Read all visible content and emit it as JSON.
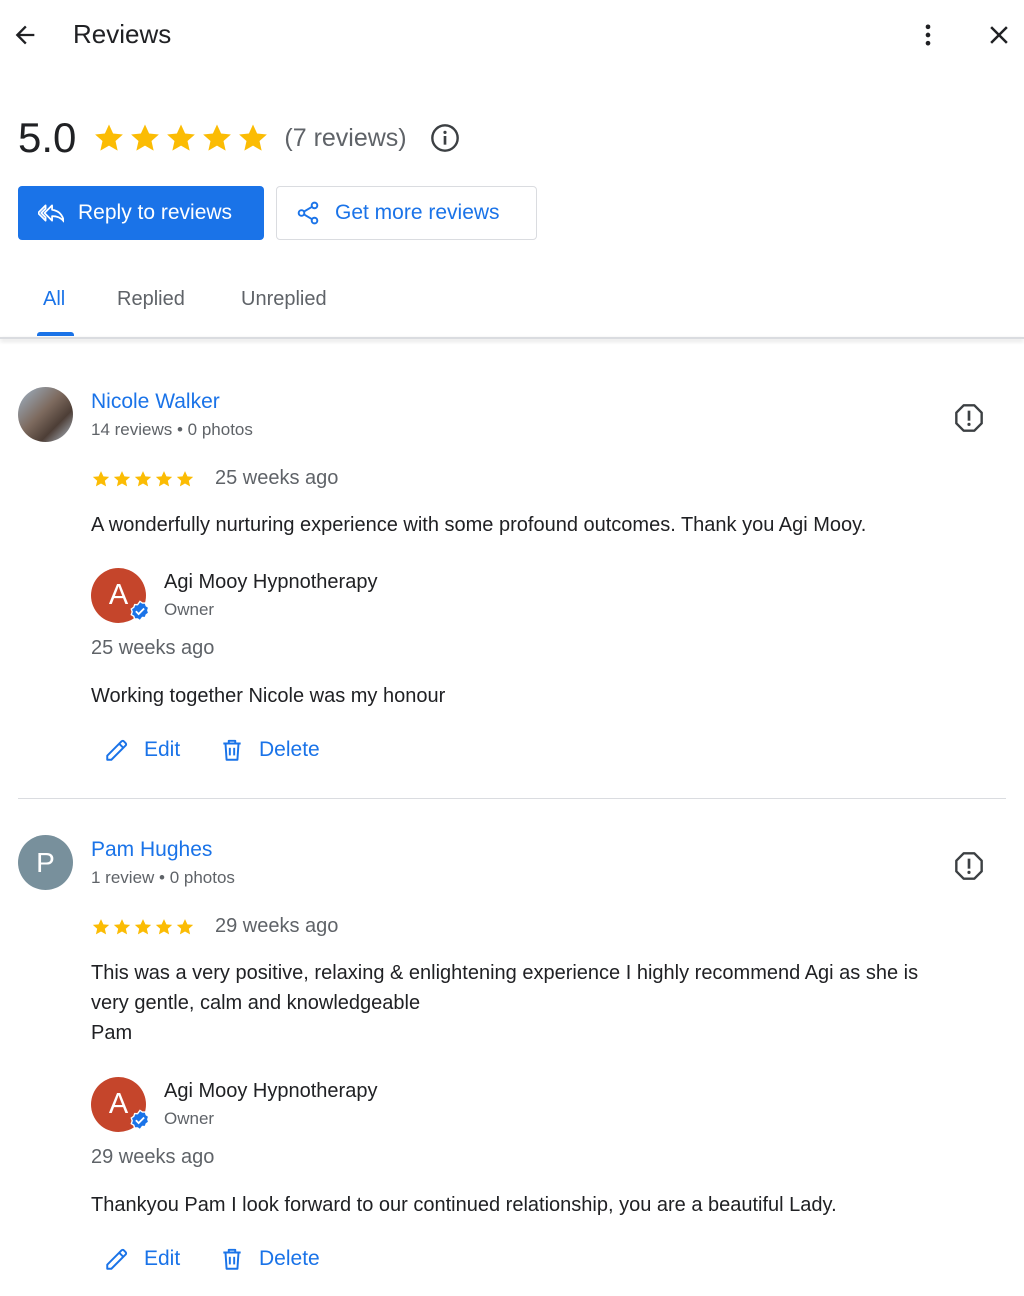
{
  "header": {
    "title": "Reviews",
    "back_icon": "arrow-left-icon",
    "more_icon": "more-vert-icon",
    "close_icon": "close-icon"
  },
  "summary": {
    "rating": "5.0",
    "stars": 5,
    "review_count": "(7 reviews)",
    "star_color": "#fbbc04"
  },
  "actions": {
    "reply_label": "Reply to reviews",
    "get_more_label": "Get more reviews",
    "accent_color": "#1a73e8"
  },
  "tabs": [
    {
      "label": "All",
      "active": true
    },
    {
      "label": "Replied",
      "active": false
    },
    {
      "label": "Unreplied",
      "active": false
    }
  ],
  "reviews": [
    {
      "name": "Nicole Walker",
      "meta": "14 reviews • 0 photos",
      "stars": 5,
      "date": "25 weeks ago",
      "text": "A wonderfully nurturing experience with some profound outcomes. Thank you Agi Mooy.",
      "reply": {
        "owner_name": "Agi Mooy Hypnotherapy",
        "owner_initial": "A",
        "role": "Owner",
        "date": "25 weeks ago",
        "text": "Working together Nicole was my honour"
      },
      "edit_label": "Edit",
      "delete_label": "Delete"
    },
    {
      "name": "Pam Hughes",
      "initial": "P",
      "meta": "1 review • 0 photos",
      "stars": 5,
      "date": "29 weeks ago",
      "text": "This was a very positive, relaxing & enlightening experience I highly recommend Agi as she is\nvery gentle, calm and knowledgeable\nPam",
      "reply": {
        "owner_name": "Agi Mooy Hypnotherapy",
        "owner_initial": "A",
        "role": "Owner",
        "date": "29 weeks ago",
        "text": "Thankyou Pam I look forward to our continued relationship, you are a beautiful Lady."
      },
      "edit_label": "Edit",
      "delete_label": "Delete"
    }
  ]
}
